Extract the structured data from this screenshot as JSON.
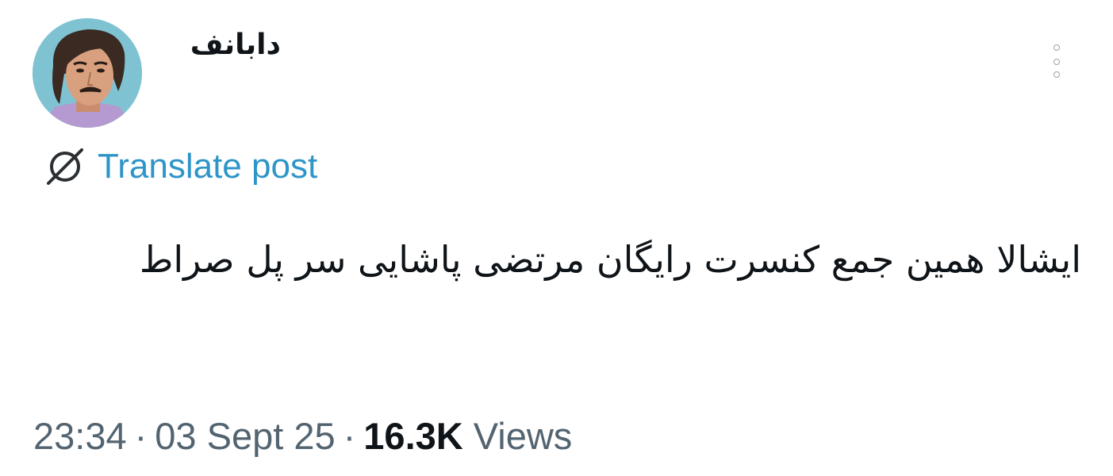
{
  "post": {
    "author": {
      "display_name": "دابانف"
    },
    "translate_label": "Translate post",
    "text": "ایشالا همین جمع کنسرت رایگان مرتضی پاشایی سر پل صراط",
    "time": "23:34",
    "date": "03 Sept 25",
    "separator": "·",
    "views_count": "16.3K",
    "views_label": "Views"
  },
  "icons": {
    "more": "more-vertical-icon",
    "translate": "globe-slash-icon"
  },
  "colors": {
    "link": "#2e95c8",
    "text": "#0f1419",
    "muted": "#536471",
    "avatar_bg": "#7fc3d3"
  }
}
